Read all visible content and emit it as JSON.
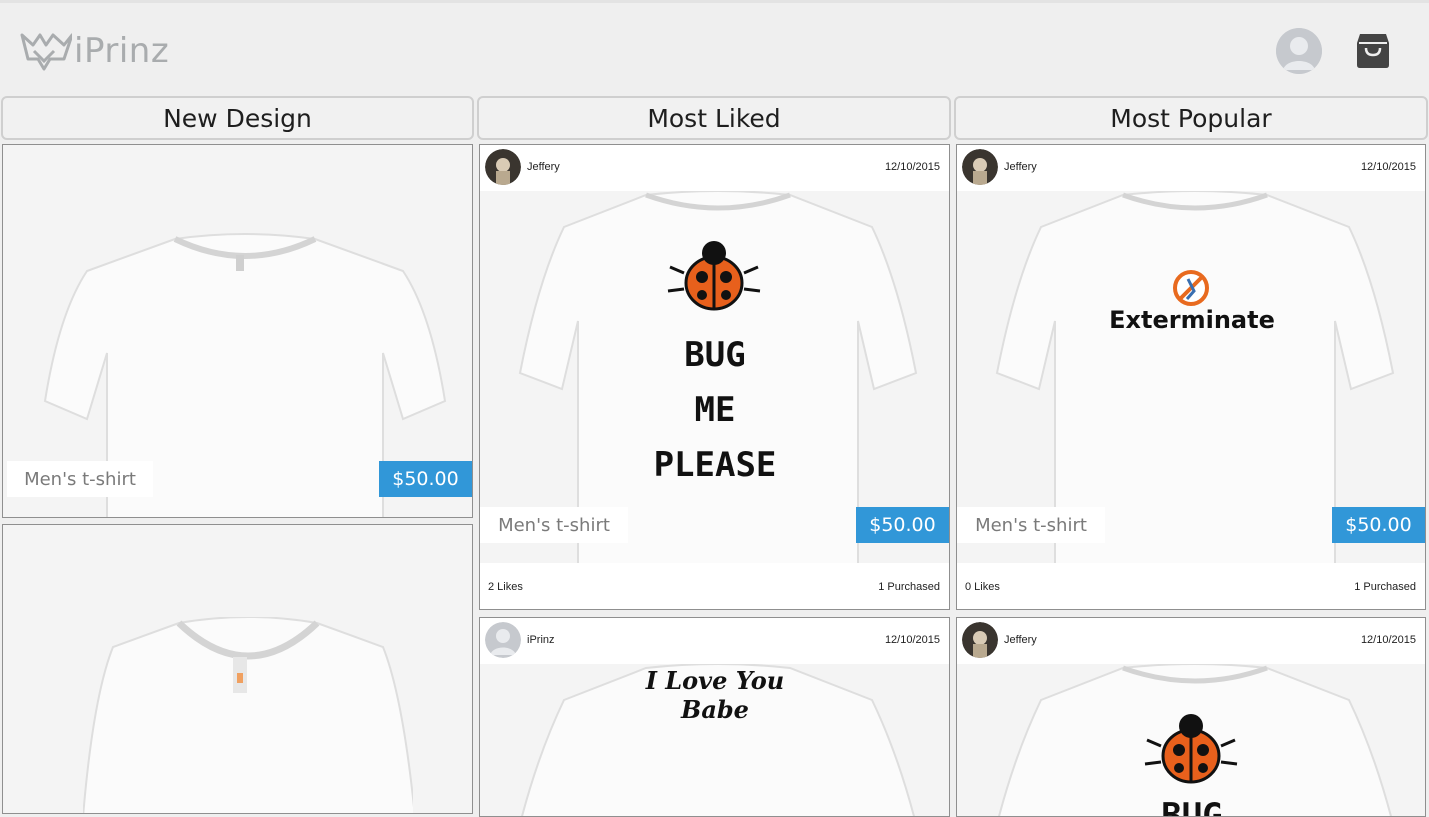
{
  "app": {
    "name": "iPrinz"
  },
  "tabs": [
    {
      "label": "New Design"
    },
    {
      "label": "Most Liked"
    },
    {
      "label": "Most Popular"
    }
  ],
  "new_design": [
    {
      "product": "Men's t-shirt",
      "price": "$50.00"
    },
    {
      "product": ""
    }
  ],
  "most_liked": [
    {
      "user": "Jeffery",
      "date": "12/10/2015",
      "design_lines": [
        "BUG",
        "ME",
        "PLEASE"
      ],
      "product": "Men's t-shirt",
      "price": "$50.00",
      "likes": "2 Likes",
      "purchased": "1  Purchased"
    },
    {
      "user": "iPrinz",
      "date": "12/10/2015",
      "design_lines": [
        "I Love You",
        "Babe"
      ]
    }
  ],
  "most_popular": [
    {
      "user": "Jeffery",
      "date": "12/10/2015",
      "design_text": "Exterminate",
      "product": "Men's t-shirt",
      "price": "$50.00",
      "likes": "0 Likes",
      "purchased": "1  Purchased"
    },
    {
      "user": "Jeffery",
      "date": "12/10/2015",
      "design_lines": [
        "BUG"
      ]
    }
  ],
  "icons": {
    "logo": "crown-logo-icon",
    "profile": "profile-avatar-icon",
    "cart": "shopping-bag-icon"
  },
  "colors": {
    "accent": "#3197d8",
    "bug_orange": "#e8601c",
    "exterminate_orange": "#e86a1f"
  }
}
